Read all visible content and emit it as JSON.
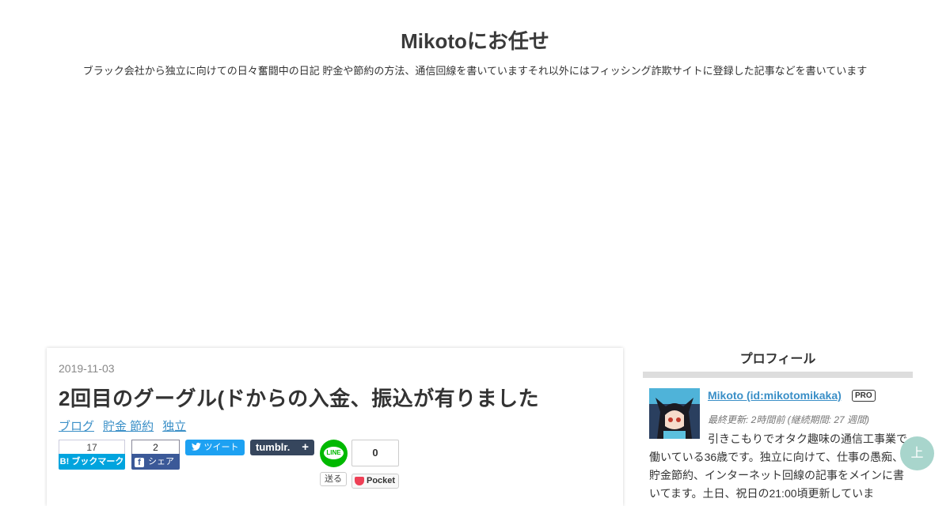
{
  "header": {
    "title": "Mikotoにお任せ",
    "description": "ブラック会社から独立に向けての日々奮闘中の日記 貯金や節約の方法、通信回線を書いていますそれ以外にはフィッシング詐欺サイトに登録した記事などを書いています"
  },
  "article": {
    "date": "2019-11-03",
    "title": "2回目のグーグル(ドからの入金、振込が有りました",
    "categories": [
      "ブログ",
      "貯金 節約",
      "独立"
    ],
    "share": {
      "hatena_count": "17",
      "hatena_label": "B! ブックマーク",
      "facebook_count": "2",
      "facebook_label": "シェア",
      "facebook_icon": "f",
      "tweet_label": "ツイート",
      "tumblr_label": "tumblr.",
      "tumblr_plus": "+",
      "line_icon_text": "LINE",
      "line_label": "送る",
      "pocket_count": "0",
      "pocket_label": "Pocket"
    }
  },
  "sidebar": {
    "profile": {
      "heading": "プロフィール",
      "name": "Mikoto (id:mikotomikaka)",
      "badge": "PRO",
      "updated": "最終更新: 2時間前 (継続期間: 27 週間)",
      "bio": "引きこもりでオタク趣味の通信工事業で働いている36歳です。独立に向けて、仕事の愚痴、貯金節約、インターネット回線の記事をメインに書いてます。土日、祝日の21:00頃更新していま"
    }
  },
  "to_top": {
    "label": "上"
  },
  "colors": {
    "link": "#3a8fc7",
    "hatena": "#00a4de",
    "facebook": "#3b5998",
    "twitter": "#1da1f2",
    "tumblr": "#36465d",
    "line": "#00b900",
    "pocket": "#ee4056",
    "to_top": "#a8d5cc"
  },
  "icons": [
    "hatena-bookmark-icon",
    "facebook-icon",
    "twitter-bird-icon",
    "tumblr-icon",
    "line-icon",
    "pocket-icon",
    "avatar-image"
  ]
}
